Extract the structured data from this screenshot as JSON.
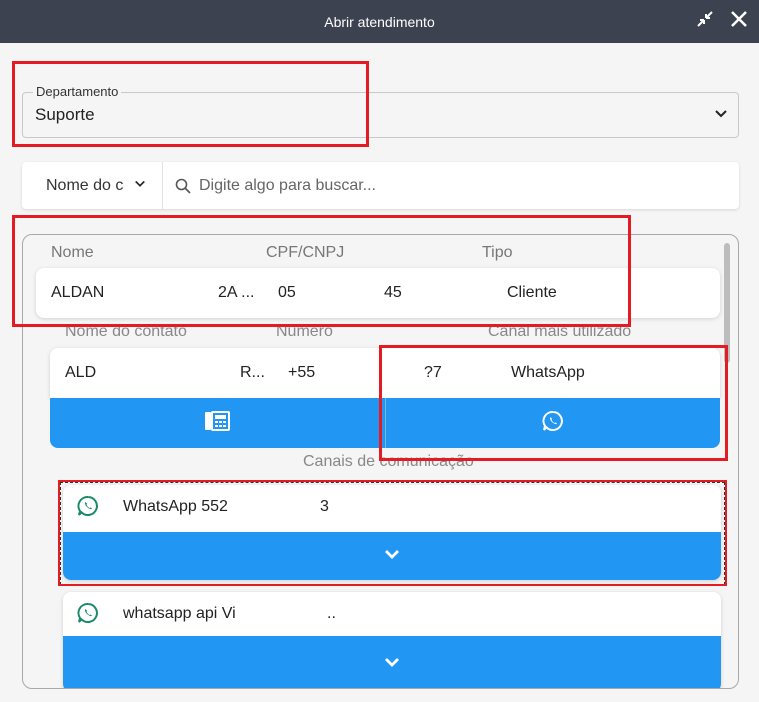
{
  "window": {
    "title": "Abrir atendimento",
    "controls": [
      "collapse-icon",
      "close-icon"
    ]
  },
  "department": {
    "label": "Departamento",
    "value": "Suporte"
  },
  "search": {
    "filter_value": "Nome do c",
    "placeholder": "Digite algo para buscar..."
  },
  "clients_table": {
    "columns": [
      "Nome",
      "CPF/CNPJ",
      "Tipo"
    ],
    "rows": [
      {
        "name": "ALDAN",
        "name_tail": "2A ...",
        "doc": "05",
        "doc_tail": "45",
        "type": "Cliente"
      }
    ]
  },
  "contacts_table": {
    "columns": [
      "Nome do contato",
      "Numero",
      "Canal mais utilizado"
    ],
    "rows": [
      {
        "name": "ALD",
        "name_tail": "R...",
        "number": "+55",
        "number_tail": "?7",
        "channel": "WhatsApp"
      }
    ],
    "actions": [
      "phone-list-icon",
      "whatsapp-icon"
    ]
  },
  "channels": {
    "title": "Canais de comunicação",
    "items": [
      {
        "label": "WhatsApp 552",
        "label_tail": "3",
        "icon": "whatsapp-icon",
        "selected": true
      },
      {
        "label": "whatsapp api Vi",
        "label_tail": "..",
        "icon": "whatsapp-icon",
        "selected": false
      }
    ]
  },
  "colors": {
    "titlebar": "#3d4250",
    "accent": "#2196f3",
    "whatsapp_icon": "#1a8a6a",
    "annotation": "#e31b23"
  }
}
